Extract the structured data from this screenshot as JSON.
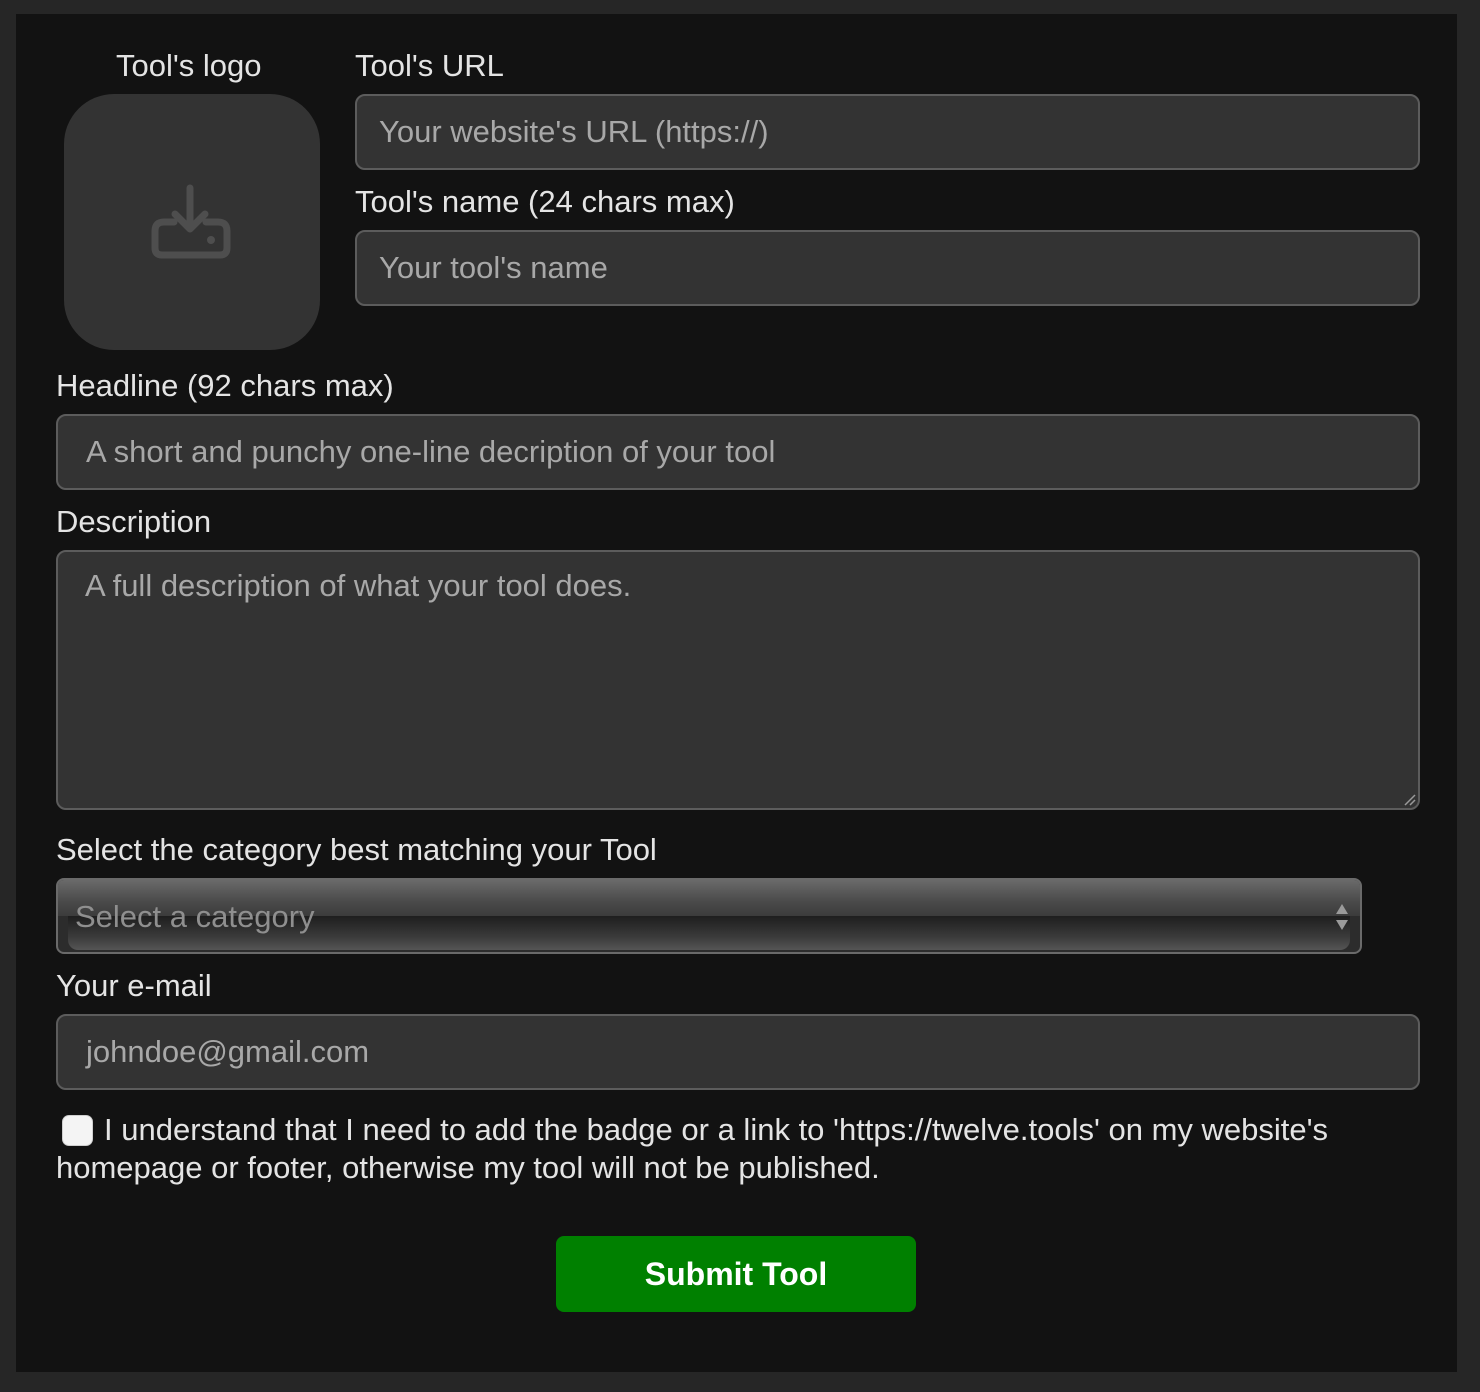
{
  "logo": {
    "label": "Tool's logo",
    "upload_icon": "upload-tray-icon"
  },
  "url": {
    "label": "Tool's URL",
    "placeholder": "Your website's URL (https://)"
  },
  "name": {
    "label": "Tool's name (24 chars max)",
    "placeholder": "Your tool's name"
  },
  "headline": {
    "label": "Headline (92 chars max)",
    "placeholder": "A short and punchy one-line decription of your tool"
  },
  "description": {
    "label": "Description",
    "placeholder": "A full description of what your tool does."
  },
  "category": {
    "label": "Select the category best matching your Tool",
    "selected": "Select a category"
  },
  "email": {
    "label": "Your e-mail",
    "placeholder": "johndoe@gmail.com"
  },
  "consent": {
    "text": "I understand that I need to add the badge or a link to 'https://twelve.tools' on my website's homepage or footer, otherwise my tool will not be published.",
    "checked": false
  },
  "submit": {
    "label": "Submit Tool"
  },
  "colors": {
    "page_bg": "#262626",
    "panel_bg": "#121212",
    "field_bg": "#333333",
    "submit_bg": "#008000"
  }
}
